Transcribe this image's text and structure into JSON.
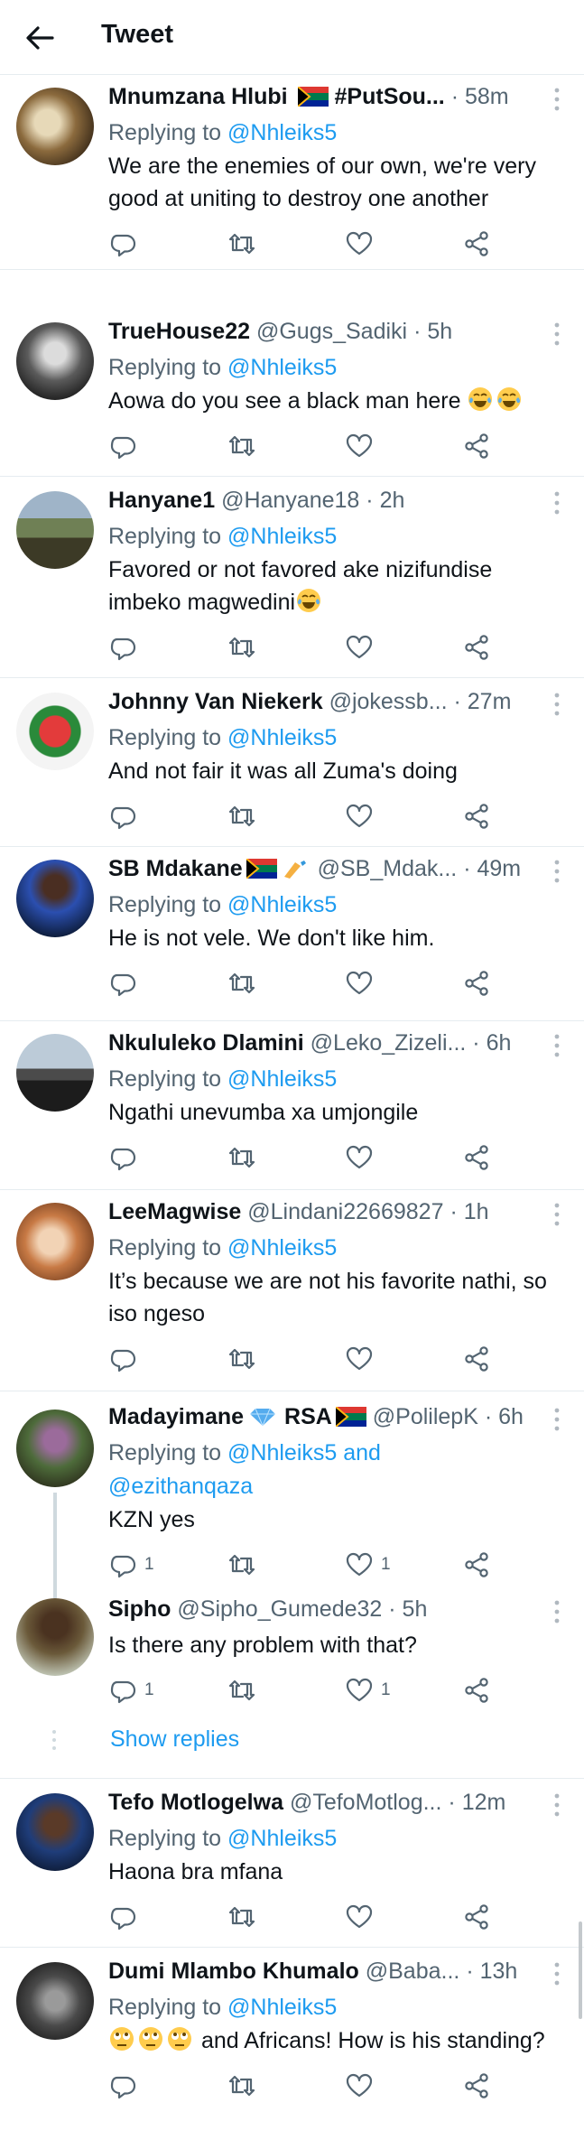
{
  "header": {
    "title": "Tweet"
  },
  "colors": {
    "link": "#1d9bf0",
    "secondary": "#536471",
    "text": "#0f1419",
    "divider": "#e6ecf0"
  },
  "tweets": [
    {
      "name": "Mnumzana Hlubi",
      "name_suffix": "#PutSou...",
      "handle": "",
      "time": "58m",
      "replying_to": "@Nhleiks5",
      "text": "We are the enemies of our own, we're very good at uniting to destroy one another",
      "reply_count": "",
      "like_count": ""
    },
    {
      "name": "TrueHouse22",
      "handle": "@Gugs_Sadiki",
      "time": "5h",
      "replying_to": "@Nhleiks5",
      "text": "Aowa do you see a black man here",
      "emoji": "joy-emoji",
      "reply_count": "",
      "like_count": ""
    },
    {
      "name": "Hanyane1",
      "handle": "@Hanyane18",
      "time": "2h",
      "replying_to": "@Nhleiks5",
      "text": "Favored or not favored ake nizifundise imbeko magwedini",
      "emoji": "joy-emoji",
      "reply_count": "",
      "like_count": ""
    },
    {
      "name": "Johnny Van Niekerk",
      "handle": "@jokessb...",
      "time": "27m",
      "replying_to": "@Nhleiks5",
      "text": "And not fair it was all Zuma's doing",
      "reply_count": "",
      "like_count": ""
    },
    {
      "name": "SB Mdakane",
      "handle": "@SB_Mdak...",
      "time": "49m",
      "replying_to": "@Nhleiks5",
      "text": "He is not vele. We don't like him.",
      "reply_count": "",
      "like_count": ""
    },
    {
      "name": "Nkululeko Dlamini",
      "handle": "@Leko_Zizeli...",
      "time": "6h",
      "replying_to": "@Nhleiks5",
      "text": "Ngathi unevumba xa umjongile",
      "reply_count": "",
      "like_count": ""
    },
    {
      "name": "LeeMagwise",
      "handle": "@Lindani22669827",
      "time": "1h",
      "replying_to": "@Nhleiks5",
      "text": "It’s because we are not his favorite nathi, so iso ngeso",
      "reply_count": "",
      "like_count": ""
    },
    {
      "name": "Madayimane",
      "name_suffix": "RSA",
      "handle": "@PolilepK",
      "time": "6h",
      "replying_to": "@Nhleiks5 and",
      "replying_to_2": "@ezithanqaza",
      "text": "KZN yes",
      "reply_count": "1",
      "like_count": "1"
    },
    {
      "name": "Sipho",
      "handle": "@Sipho_Gumede32",
      "time": "5h",
      "replying_to": "",
      "text": "Is there any problem with that?",
      "reply_count": "1",
      "like_count": "1"
    },
    {
      "name": "Tefo Motlogelwa",
      "handle": "@TefoMotlog...",
      "time": "12m",
      "replying_to": "@Nhleiks5",
      "text": "Haona bra mfana",
      "reply_count": "",
      "like_count": ""
    },
    {
      "name": "Dumi Mlambo Khumalo",
      "handle": "@Baba...",
      "time": "13h",
      "replying_to": "@Nhleiks5",
      "text": "and Africans! How is his standing?",
      "reply_count": "",
      "like_count": ""
    }
  ],
  "reply_prefix": "Replying to",
  "show_replies": "Show replies",
  "dot": "·"
}
